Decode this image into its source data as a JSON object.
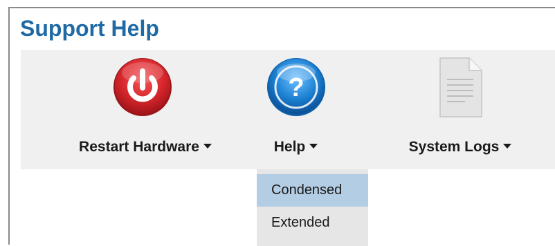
{
  "page": {
    "title": "Support Help"
  },
  "toolbar": {
    "items": [
      {
        "label": "Restart Hardware",
        "icon": "power-icon"
      },
      {
        "label": "Help",
        "icon": "help-question-icon"
      },
      {
        "label": "System Logs",
        "icon": "document-icon"
      }
    ]
  },
  "help_menu": {
    "items": [
      {
        "label": "Condensed",
        "highlighted": true
      },
      {
        "label": "Extended",
        "highlighted": false
      }
    ]
  },
  "colors": {
    "title": "#1f6aa5",
    "toolbar_bg": "#f0f0f0",
    "menu_bg": "#e6e6e6",
    "menu_highlight": "#b3cde4",
    "power_red": "#d7262b",
    "help_blue": "#1b7fd1"
  }
}
